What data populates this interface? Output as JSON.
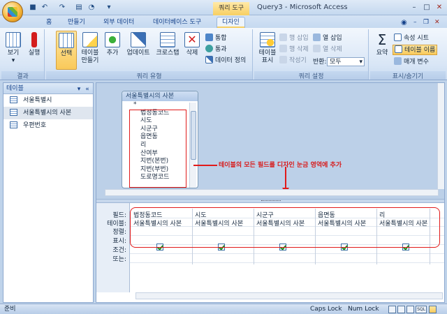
{
  "titlebar": {
    "context_tab": "쿼리 도구",
    "title": "Query3 - Microsoft Access",
    "icons": [
      "save-icon",
      "undo-icon",
      "redo-icon",
      "print-preview-icon",
      "help-icon",
      "customize-qat-icon"
    ]
  },
  "tabs": [
    "홈",
    "만들기",
    "외부 데이터",
    "데이터베이스 도구",
    "디자인"
  ],
  "ribbon": {
    "results": {
      "title": "결과",
      "view": "보기",
      "run": "실행"
    },
    "query_type": {
      "title": "쿼리 유형",
      "select": "선택",
      "make_table": "테이블\n만들기",
      "append": "추가",
      "update": "업데이트",
      "crosstab": "크로스탭",
      "delete": "삭제",
      "union": "통합",
      "passthrough": "통과",
      "data_definition": "데이터 정의"
    },
    "query_setup": {
      "title": "쿼리 설정",
      "show_table": "테이블\n표시",
      "insert_rows": "행 삽입",
      "delete_rows": "행 삭제",
      "builder": "작성기",
      "insert_cols": "열 삽입",
      "delete_cols": "열 삭제",
      "return_label": "반환:",
      "return_value": "모두"
    },
    "show_hide": {
      "title": "표시/숨기기",
      "totals": "요약",
      "property_sheet": "속성 시트",
      "table_names": "테이블 이름",
      "parameters": "매개 변수"
    }
  },
  "nav_pane": {
    "header": "테이블",
    "items": [
      "서울특별시",
      "서울특별시의 사본",
      "우편번호"
    ]
  },
  "field_list": {
    "title": "서울특별시의 사본",
    "star": "*",
    "fields": [
      "법정동코드",
      "시도",
      "시군구",
      "읍면동",
      "리",
      "산여부",
      "지번(본번)",
      "지번(부번)",
      "도로명코드"
    ]
  },
  "annotation": "테이블의 모든 필드를 디자인 눈금 영역에 추가",
  "grid": {
    "row_labels": [
      "필드:",
      "테이블:",
      "정렬:",
      "표시:",
      "조건:",
      "또는:"
    ],
    "columns": [
      {
        "field": "법정동코드",
        "table": "서울특별시의 사본",
        "show": true
      },
      {
        "field": "시도",
        "table": "서울특별시의 사본",
        "show": true
      },
      {
        "field": "시군구",
        "table": "서울특별시의 사본",
        "show": true
      },
      {
        "field": "읍면동",
        "table": "서울특별시의 사본",
        "show": true
      },
      {
        "field": "리",
        "table": "서울특별시의 사본",
        "show": true
      }
    ]
  },
  "status": {
    "left": "준비",
    "caps": "Caps Lock",
    "num": "Num Lock",
    "view_sql": "SQL"
  }
}
